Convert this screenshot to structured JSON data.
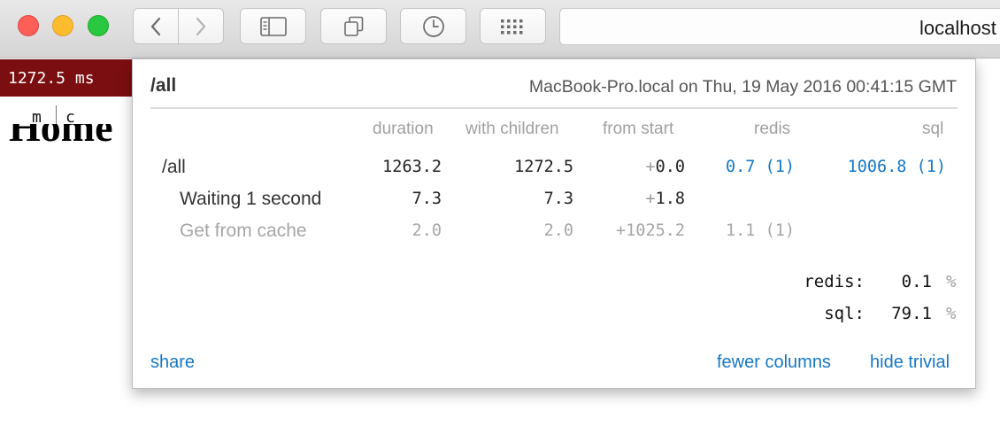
{
  "browser": {
    "address": "localhost",
    "icons": [
      "back-icon",
      "forward-icon",
      "sidebar-icon",
      "tabs-icon",
      "history-icon",
      "grid-icon"
    ]
  },
  "page": {
    "timing_badge": "1272.5 ms",
    "mc_m": "m",
    "mc_c": "c",
    "heading": "Home"
  },
  "profiler": {
    "title": "/all",
    "machine": "MacBook-Pro.local on Thu, 19 May 2016 00:41:15 GMT",
    "columns": {
      "duration": "duration",
      "with_children": "with children",
      "from_start": "from start",
      "redis": "redis",
      "sql": "sql"
    },
    "rows": [
      {
        "name": "/all",
        "duration": "1263.2",
        "with_children": "1272.5",
        "plus": "+",
        "from_start": "0.0",
        "redis": "0.7 (1)",
        "sql": "1006.8 (1)"
      },
      {
        "name": "Waiting 1 second",
        "duration": "7.3",
        "with_children": "7.3",
        "plus": "+",
        "from_start": "1.8",
        "redis": "",
        "sql": ""
      },
      {
        "name": "Get from cache",
        "duration": "2.0",
        "with_children": "2.0",
        "plus": "+",
        "from_start": "1025.2",
        "redis": "1.1 (1)",
        "sql": ""
      }
    ],
    "summary": [
      {
        "label": "redis:",
        "value": "0.1",
        "pct": "%"
      },
      {
        "label": "sql:",
        "value": "79.1",
        "pct": "%"
      }
    ],
    "links": {
      "share": "share",
      "fewer_columns": "fewer columns",
      "hide_trivial": "hide trivial"
    }
  }
}
